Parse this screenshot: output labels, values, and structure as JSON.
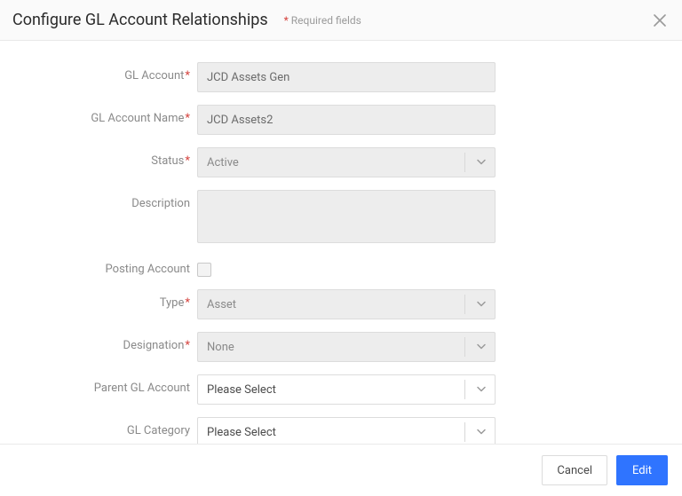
{
  "header": {
    "title": "Configure GL Account Relationships",
    "req_star": "*",
    "req_text": " Required fields"
  },
  "form": {
    "gl_account": {
      "label": "GL Account",
      "value": "JCD Assets Gen"
    },
    "gl_account_name": {
      "label": "GL Account Name",
      "value": "JCD Assets2"
    },
    "status": {
      "label": "Status",
      "value": "Active"
    },
    "description": {
      "label": "Description",
      "value": ""
    },
    "posting_account": {
      "label": "Posting Account"
    },
    "type": {
      "label": "Type",
      "value": "Asset"
    },
    "designation": {
      "label": "Designation",
      "value": "None"
    },
    "parent_gl_account": {
      "label": "Parent GL Account",
      "value": "Please Select"
    },
    "gl_category": {
      "label": "GL Category",
      "value": "Please Select"
    }
  },
  "footer": {
    "cancel": "Cancel",
    "edit": "Edit"
  }
}
